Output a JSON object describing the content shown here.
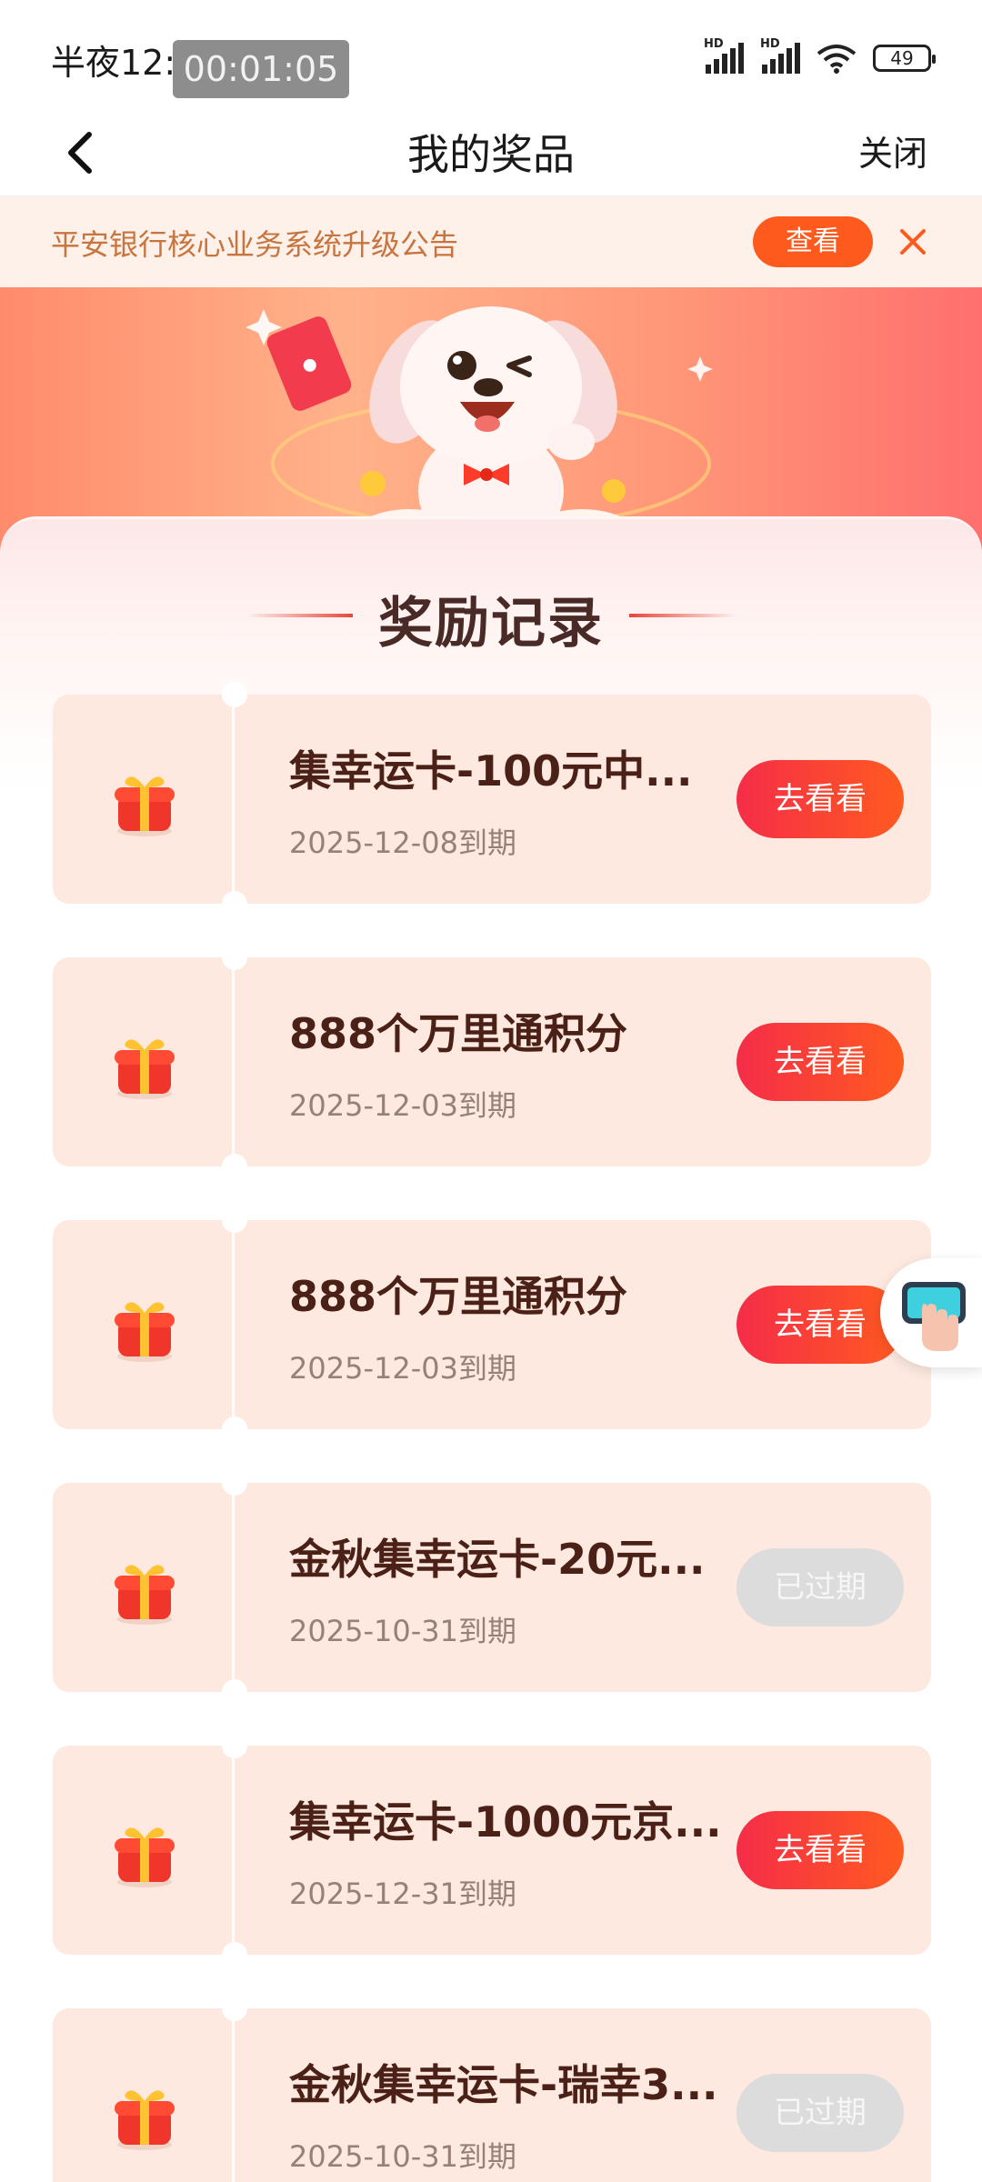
{
  "status_bar": {
    "time": "半夜12:01",
    "recording_timer": "00:01:05",
    "signal_1_label": "HD",
    "signal_2_label": "HD",
    "battery": "49"
  },
  "nav": {
    "title": "我的奖品",
    "close_label": "关闭"
  },
  "notice": {
    "text": "平安银行核心业务系统升级公告",
    "view_label": "查看"
  },
  "section": {
    "title": "奖励记录"
  },
  "rewards": [
    {
      "name": "集幸运卡-100元中...",
      "expiry": "2025-12-08到期",
      "action": "去看看",
      "expired": false
    },
    {
      "name": "888个万里通积分",
      "expiry": "2025-12-03到期",
      "action": "去看看",
      "expired": false
    },
    {
      "name": "888个万里通积分",
      "expiry": "2025-12-03到期",
      "action": "去看看",
      "expired": false
    },
    {
      "name": "金秋集幸运卡-20元...",
      "expiry": "2025-10-31到期",
      "action": "已过期",
      "expired": true
    },
    {
      "name": "集幸运卡-1000元京...",
      "expiry": "2025-12-31到期",
      "action": "去看看",
      "expired": false
    },
    {
      "name": "金秋集幸运卡-瑞幸3...",
      "expiry": "2025-10-31到期",
      "action": "已过期",
      "expired": true
    }
  ],
  "colors": {
    "accent": "#ff5a1e",
    "button_gradient_start": "#f52d48",
    "button_gradient_end": "#ff5a20",
    "expired_button": "#dcdcdc",
    "card_bg": "#fde9df",
    "notice_text": "#c8743e"
  },
  "icons": {
    "back": "chevron-left-icon",
    "notice_close": "close-icon",
    "reward": "gift-box-icon",
    "floating_helper": "touch-guide-icon"
  }
}
